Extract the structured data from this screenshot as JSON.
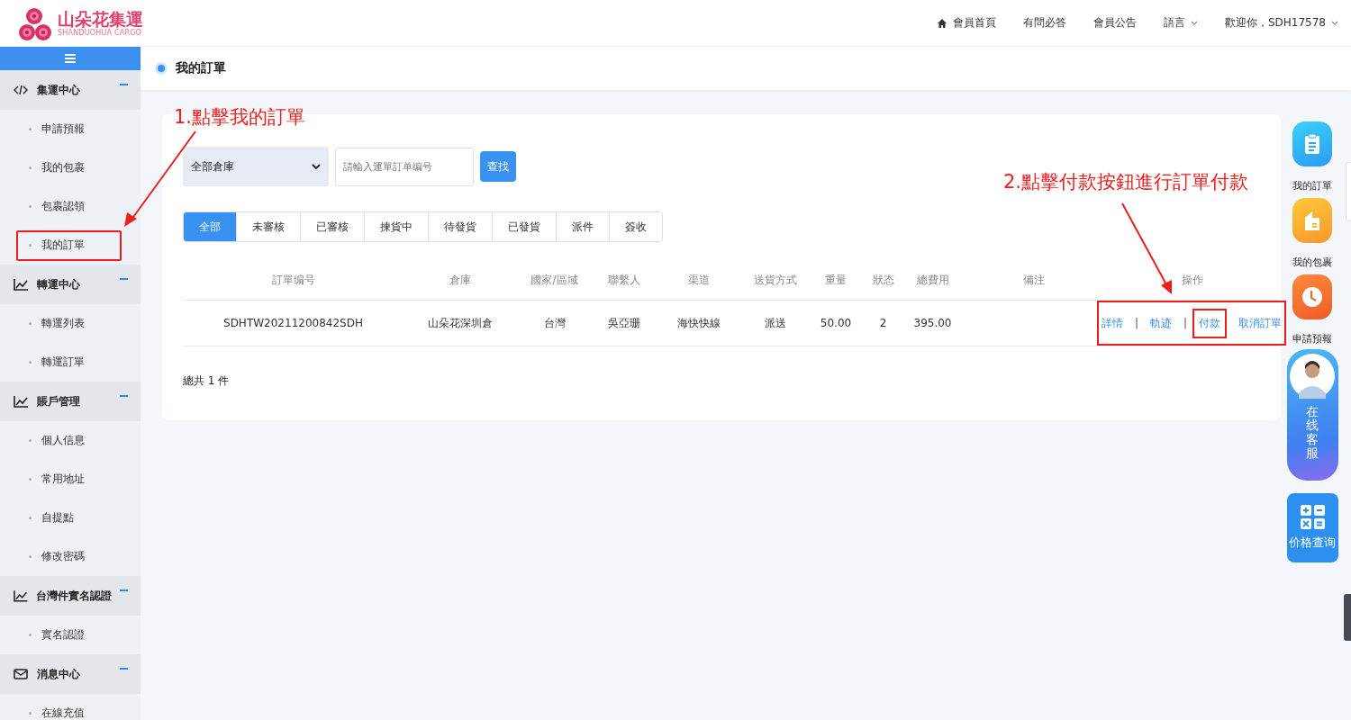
{
  "logo": {
    "title": "山朵花集運",
    "subtitle": "SHANDUOHUA CARGO"
  },
  "top_nav": [
    {
      "kind": "home",
      "label": "會員首頁"
    },
    {
      "kind": "link",
      "label": "有問必答"
    },
    {
      "kind": "link",
      "label": "會員公告"
    },
    {
      "kind": "dropdown",
      "label": "語言"
    },
    {
      "kind": "dropdown",
      "label": "歡迎你，SDH17578"
    }
  ],
  "sidebar": {
    "groups": [
      {
        "kind": "code",
        "label": "集運中心",
        "expanded": true,
        "children": [
          {
            "label": "申請預報",
            "highlighted": false
          },
          {
            "label": "我的包裹",
            "highlighted": false
          },
          {
            "label": "包裹認領",
            "highlighted": false
          },
          {
            "label": "我的訂單",
            "highlighted": true
          }
        ]
      },
      {
        "kind": "chart",
        "label": "轉運中心",
        "expanded": true,
        "children": [
          {
            "label": "轉運列表",
            "highlighted": false
          },
          {
            "label": "轉運訂單",
            "highlighted": false
          }
        ]
      },
      {
        "kind": "chart",
        "label": "賬戶管理",
        "expanded": true,
        "children": [
          {
            "label": "個人信息",
            "highlighted": false
          },
          {
            "label": "常用地址",
            "highlighted": false
          },
          {
            "label": "自提點",
            "highlighted": false
          },
          {
            "label": "修改密碼",
            "highlighted": false
          }
        ]
      },
      {
        "kind": "chart",
        "label": "台灣件實名認證",
        "expanded": true,
        "children": [
          {
            "label": "實名認證",
            "highlighted": false
          }
        ]
      },
      {
        "kind": "mail",
        "label": "消息中心",
        "expanded": true,
        "children": [
          {
            "label": "在線充值",
            "highlighted": false
          }
        ]
      }
    ]
  },
  "page_title": "我的訂單",
  "filters": {
    "warehouse": "全部倉庫",
    "search": {
      "placeholder": "請輸入運單訂单编号"
    },
    "search_button": "查找"
  },
  "tabs": [
    {
      "label": "全部",
      "selected": true
    },
    {
      "label": "未審核",
      "selected": false
    },
    {
      "label": "已審核",
      "selected": false
    },
    {
      "label": "揀貨中",
      "selected": false
    },
    {
      "label": "待發貨",
      "selected": false
    },
    {
      "label": "已發貨",
      "selected": false
    },
    {
      "label": "派件",
      "selected": false
    },
    {
      "label": "簽收",
      "selected": false
    }
  ],
  "table": {
    "columns": [
      "訂單编号",
      "倉庫",
      "國家/區域",
      "聯繫人",
      "渠道",
      "送貨方式",
      "重量",
      "狀态",
      "總費用",
      "備注",
      "操作"
    ],
    "rows": [
      {
        "cells": [
          "SDHTW20211200842SDH",
          "山朵花深圳倉",
          "台灣",
          "吳亞珊",
          "海快快線",
          "派送",
          "50.00",
          "2",
          "395.00"
        ],
        "actions_highlighted": true,
        "actions": [
          {
            "kind": "link",
            "label": "詳情",
            "highlighted": false
          },
          {
            "kind": "separator",
            "label": "|"
          },
          {
            "kind": "link",
            "label": "軌迹",
            "highlighted": false
          },
          {
            "kind": "separator",
            "label": "|"
          },
          {
            "kind": "link",
            "label": "付款",
            "highlighted": true
          },
          {
            "kind": "link",
            "label": "取消訂單",
            "highlighted": false
          }
        ]
      }
    ]
  },
  "total": "總共 1 件",
  "dock": [
    {
      "kind": "clipboard",
      "label": "我的訂單"
    },
    {
      "kind": "package",
      "label": "我的包裹"
    },
    {
      "kind": "clock",
      "label": "申請預報"
    },
    {
      "kind": "service",
      "label": "在线客服"
    },
    {
      "kind": "calculator",
      "label": "价格查询"
    }
  ],
  "annotations": [
    {
      "text": "1.點擊我的訂單"
    },
    {
      "text": "2.點擊付款按鈕進行訂單付款"
    }
  ]
}
